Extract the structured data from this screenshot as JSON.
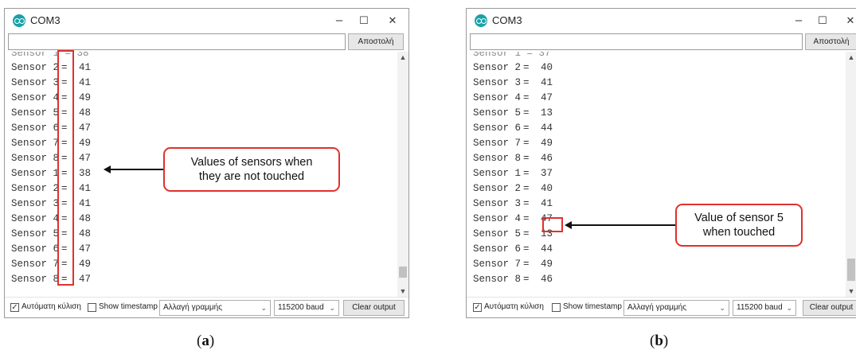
{
  "panel_a": {
    "title": "COM3",
    "minimize": "–",
    "maximize": "☐",
    "close": "✕",
    "send_label": "Αποστολή",
    "input_value": "",
    "lines": [
      {
        "label": "Sensor 2",
        "value": "41"
      },
      {
        "label": "Sensor 3",
        "value": "41"
      },
      {
        "label": "Sensor 4",
        "value": "49"
      },
      {
        "label": "Sensor 5",
        "value": "48"
      },
      {
        "label": "Sensor 6",
        "value": "47"
      },
      {
        "label": "Sensor 7",
        "value": "49"
      },
      {
        "label": "Sensor 8",
        "value": "47"
      },
      {
        "label": "Sensor 1",
        "value": "38"
      },
      {
        "label": "Sensor 2",
        "value": "41"
      },
      {
        "label": "Sensor 3",
        "value": "41"
      },
      {
        "label": "Sensor 4",
        "value": "48"
      },
      {
        "label": "Sensor 5",
        "value": "48"
      },
      {
        "label": "Sensor 6",
        "value": "47"
      },
      {
        "label": "Sensor 7",
        "value": "49"
      },
      {
        "label": "Sensor 8",
        "value": "47"
      }
    ],
    "autoscroll_label": "Αυτόματη κύλιση",
    "autoscroll_checked": "✓",
    "timestamp_label": "Show timestamp",
    "line_ending": "Αλλαγή γραμμής",
    "baud": "115200 baud",
    "clear_label": "Clear output",
    "annotation": "Values of sensors when\nthey are not touched",
    "caption_open": "(",
    "caption_letter": "a",
    "caption_close": ")"
  },
  "panel_b": {
    "title": "COM3",
    "minimize": "–",
    "maximize": "☐",
    "close": "✕",
    "send_label": "Αποστολή",
    "input_value": "",
    "lines": [
      {
        "label": "Sensor 2",
        "value": "40"
      },
      {
        "label": "Sensor 3",
        "value": "41"
      },
      {
        "label": "Sensor 4",
        "value": "47"
      },
      {
        "label": "Sensor 5",
        "value": "13"
      },
      {
        "label": "Sensor 6",
        "value": "44"
      },
      {
        "label": "Sensor 7",
        "value": "49"
      },
      {
        "label": "Sensor 8",
        "value": "46"
      },
      {
        "label": "Sensor 1",
        "value": "37"
      },
      {
        "label": "Sensor 2",
        "value": "40"
      },
      {
        "label": "Sensor 3",
        "value": "41"
      },
      {
        "label": "Sensor 4",
        "value": "47"
      },
      {
        "label": "Sensor 5",
        "value": "13"
      },
      {
        "label": "Sensor 6",
        "value": "44"
      },
      {
        "label": "Sensor 7",
        "value": "49"
      },
      {
        "label": "Sensor 8",
        "value": "46"
      }
    ],
    "autoscroll_label": "Αυτόματη κύλιση",
    "autoscroll_checked": "✓",
    "timestamp_label": "Show timestamp",
    "line_ending": "Αλλαγή γραμμής",
    "baud": "115200 baud",
    "clear_label": "Clear output",
    "annotation": "Value of sensor 5\nwhen touched",
    "caption_open": "(",
    "caption_letter": "b",
    "caption_close": ")"
  },
  "icons": {
    "app": "arduino-icon",
    "scroll_up": "▲",
    "scroll_down": "▼",
    "caret": "⌄"
  },
  "colors": {
    "annotation": "#e0312e",
    "app_icon": "#17a2a8"
  }
}
